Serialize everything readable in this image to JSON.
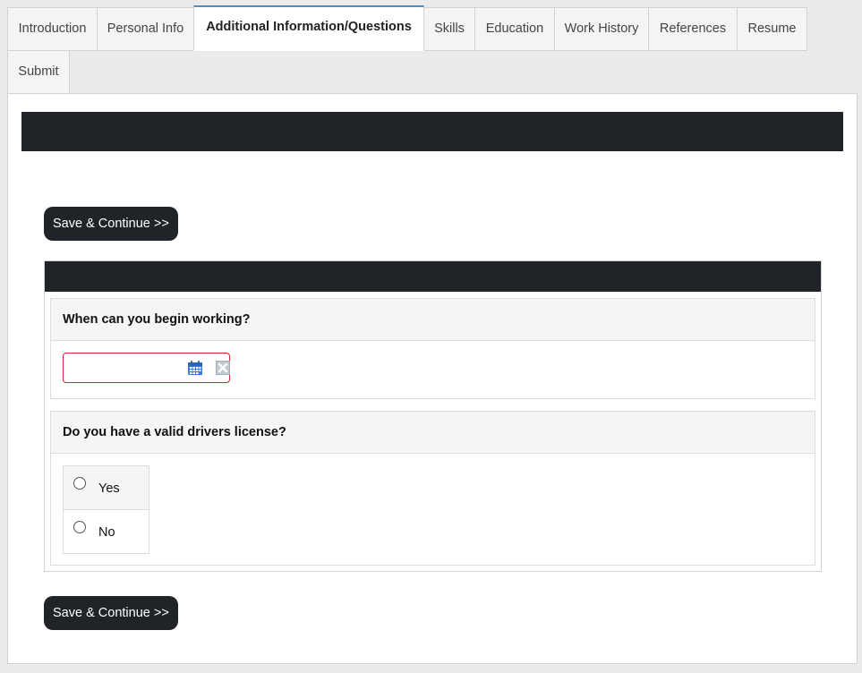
{
  "tabs": [
    {
      "label": "Introduction"
    },
    {
      "label": "Personal Info"
    },
    {
      "label": "Additional Information/Questions",
      "active": true
    },
    {
      "label": "Skills"
    },
    {
      "label": "Education"
    },
    {
      "label": "Work History"
    },
    {
      "label": "References"
    },
    {
      "label": "Resume"
    },
    {
      "label": "Submit"
    }
  ],
  "buttons": {
    "save_continue_top": "Save & Continue >>",
    "save_continue_bottom": "Save & Continue >>"
  },
  "questions": {
    "start_date": {
      "label": "When can you begin working?",
      "value": "",
      "validation_border_color": "#d9252f",
      "icons": [
        "calendar-icon",
        "clear-icon"
      ]
    },
    "drivers_license": {
      "label": "Do you have a valid drivers license?",
      "options": [
        {
          "label": "Yes",
          "selected": false
        },
        {
          "label": "No",
          "selected": false
        }
      ]
    }
  },
  "colors": {
    "dark_bar": "#202328",
    "active_tab_accent": "#4a90c8",
    "page_background": "#ebebeb"
  }
}
